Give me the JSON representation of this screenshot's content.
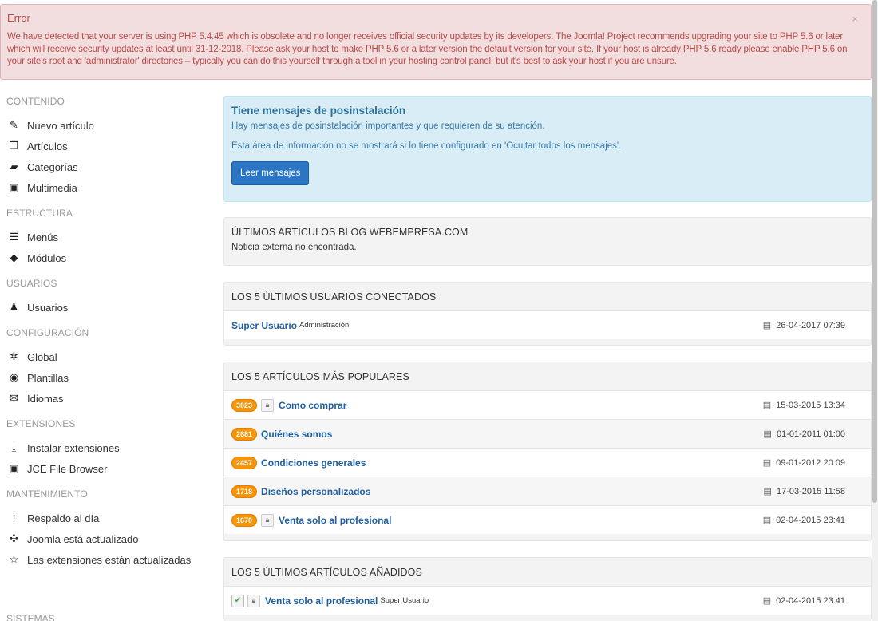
{
  "alert": {
    "heading": "Error",
    "message": "We have detected that your server is using PHP 5.4.45 which is obsolete and no longer receives official security updates by its developers. The Joomla! Project recommends upgrading your site to PHP 5.6 or later which will receive security updates at least until 31-12-2018. Please ask your host to make PHP 5.6 or a later version the default version for your site. If your host is already PHP 5.6 ready please enable PHP 5.6 on your site's root and 'administrator' directories – typically you can do this yourself through a tool in your hosting control panel, but it's best to ask your host if you are unsure.",
    "close": "×"
  },
  "sidebar": {
    "sections": [
      {
        "heading": "CONTENIDO",
        "items": [
          {
            "label": "Nuevo artículo",
            "icon": "pencil-icon",
            "glyph": "✎"
          },
          {
            "label": "Artículos",
            "icon": "stack-icon",
            "glyph": "❐"
          },
          {
            "label": "Categorías",
            "icon": "folder-icon",
            "glyph": "▰"
          },
          {
            "label": "Multimedia",
            "icon": "image-icon",
            "glyph": "▣"
          }
        ]
      },
      {
        "heading": "ESTRUCTURA",
        "items": [
          {
            "label": "Menús",
            "icon": "list-icon",
            "glyph": "☰"
          },
          {
            "label": "Módulos",
            "icon": "cube-icon",
            "glyph": "◆"
          }
        ]
      },
      {
        "heading": "USUARIOS",
        "items": [
          {
            "label": "Usuarios",
            "icon": "users-icon",
            "glyph": "♟"
          }
        ]
      },
      {
        "heading": "CONFIGURACIÓN",
        "items": [
          {
            "label": "Global",
            "icon": "cog-icon",
            "glyph": "✲"
          },
          {
            "label": "Plantillas",
            "icon": "eye-icon",
            "glyph": "◉"
          },
          {
            "label": "Idiomas",
            "icon": "comments-icon",
            "glyph": "✉"
          }
        ]
      },
      {
        "heading": "EXTENSIONES",
        "items": [
          {
            "label": "Instalar extensiones",
            "icon": "download-icon",
            "glyph": "⤓"
          },
          {
            "label": "JCE File Browser",
            "icon": "picture-icon",
            "glyph": "▣"
          }
        ]
      },
      {
        "heading": "MANTENIMIENTO",
        "items": [
          {
            "label": "Respaldo al día",
            "icon": "warning-icon",
            "glyph": "!"
          },
          {
            "label": "Joomla está actualizado",
            "icon": "joomla-icon",
            "glyph": "✣"
          },
          {
            "label": "Las extensiones están actualizadas",
            "icon": "star-icon",
            "glyph": "☆"
          }
        ]
      }
    ],
    "cut_heading": "SISTEMAS"
  },
  "postinstall": {
    "title": "Tiene mensajes de posinstalación",
    "line1": "Hay mensajes de posinstalación importantes y que requieren de su atención.",
    "line2": "Esta área de información no se mostrará si lo tiene configurado en 'Ocultar todos los mensajes'.",
    "button": "Leer mensajes"
  },
  "blog": {
    "heading": "ÚLTIMOS ARTÍCULOS BLOG WEBEMPRESA.COM",
    "text": "Noticia externa no encontrada."
  },
  "logged": {
    "heading": "LOS 5 ÚLTIMOS USUARIOS CONECTADOS",
    "rows": [
      {
        "name": "Super Usuario",
        "area": "Administración",
        "date": "26-04-2017 07:39"
      }
    ]
  },
  "popular": {
    "heading": "LOS 5 ARTÍCULOS MÁS POPULARES",
    "rows": [
      {
        "hits": "3023",
        "locked": true,
        "title": "Como comprar",
        "date": "15-03-2015 13:34"
      },
      {
        "hits": "2881",
        "locked": false,
        "title": "Quiénes somos",
        "date": "01-01-2011 01:00"
      },
      {
        "hits": "2457",
        "locked": false,
        "title": "Condiciones generales",
        "date": "09-01-2012 20:09"
      },
      {
        "hits": "1718",
        "locked": false,
        "title": "Diseños personalizados",
        "date": "17-03-2015 11:58"
      },
      {
        "hits": "1670",
        "locked": true,
        "title": "Venta solo al profesional",
        "date": "02-04-2015 23:41"
      }
    ]
  },
  "latest": {
    "heading": "LOS 5 ÚLTIMOS ARTÍCULOS AÑADIDOS",
    "rows": [
      {
        "title": "Venta solo al profesional",
        "author": "Super Usuario",
        "date": "02-04-2015 23:41"
      }
    ]
  },
  "colors": {
    "accent": "#2a75c4",
    "badge": "#f89406",
    "error_bg": "#f2dede",
    "info_bg": "#d9edf7"
  }
}
